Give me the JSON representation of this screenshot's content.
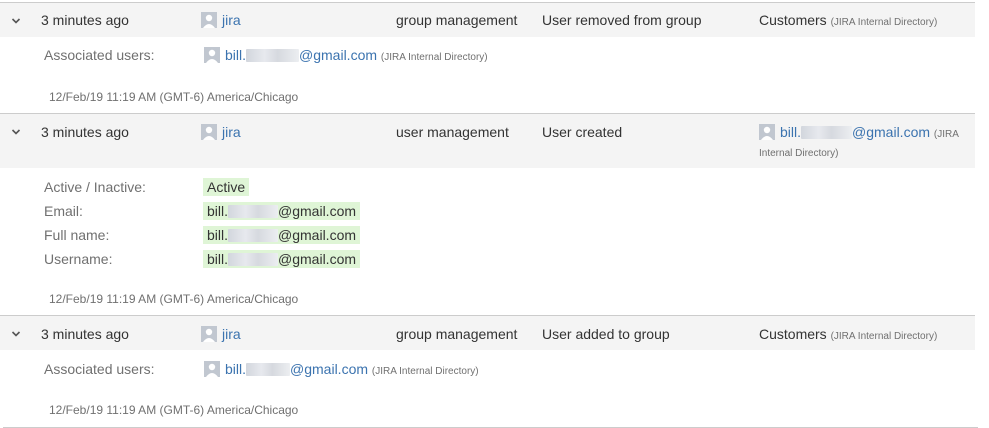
{
  "entries": [
    {
      "time": "3 minutes ago",
      "author": "jira",
      "category": "group management",
      "summary": "User removed from group",
      "object": "Customers",
      "object_dir": "(JIRA Internal Directory)",
      "assoc_label": "Associated users:",
      "assoc_user_prefix": "bill.",
      "assoc_user_suffix": "@gmail.com",
      "assoc_dir": "(JIRA Internal Directory)",
      "timestamp": "12/Feb/19 11:19 AM (GMT-6) America/Chicago"
    },
    {
      "time": "3 minutes ago",
      "author": "jira",
      "category": "user management",
      "summary": "User created",
      "object_user_prefix": "bill.",
      "object_user_suffix": "@gmail.com",
      "object_dir_a": "(JIRA",
      "object_dir_b": "Internal Directory)",
      "fields": [
        {
          "label": "Active / Inactive:",
          "prefix": "Active",
          "suffix": ""
        },
        {
          "label": "Email:",
          "prefix": "bill.",
          "suffix": "@gmail.com"
        },
        {
          "label": "Full name:",
          "prefix": "bill.",
          "suffix": "@gmail.com"
        },
        {
          "label": "Username:",
          "prefix": "bill.",
          "suffix": "@gmail.com"
        }
      ],
      "timestamp": "12/Feb/19 11:19 AM (GMT-6) America/Chicago"
    },
    {
      "time": "3 minutes ago",
      "author": "jira",
      "category": "group management",
      "summary": "User added to group",
      "object": "Customers",
      "object_dir": "(JIRA Internal Directory)",
      "assoc_label": "Associated users:",
      "assoc_user_prefix": "bill.",
      "assoc_user_suffix": "@gmail.com",
      "assoc_dir": "(JIRA Internal Directory)",
      "timestamp": "12/Feb/19 11:19 AM (GMT-6) America/Chicago"
    }
  ],
  "icons": {
    "expand": "chevron-down-icon",
    "avatar": "user-avatar-icon"
  },
  "colors": {
    "link": "#3b73af",
    "row_bg": "#f4f4f4",
    "diff_bg": "#dff5d6",
    "muted": "#707070"
  }
}
